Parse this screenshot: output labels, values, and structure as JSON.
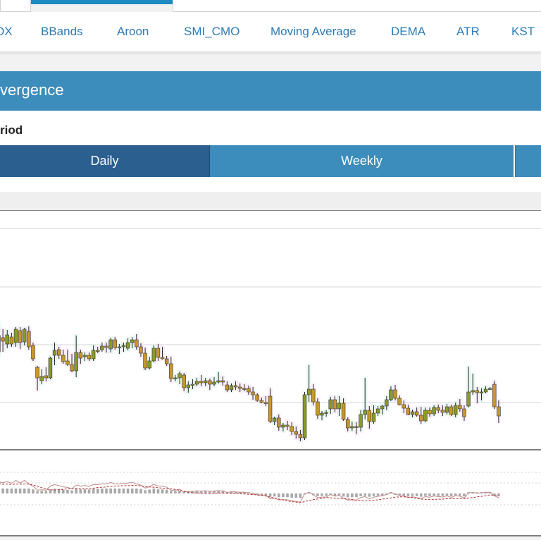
{
  "nav_tabs": [
    "DX",
    "BBands",
    "Aroon",
    "SMI_CMO",
    "Moving Average",
    "DEMA",
    "ATR",
    "KST"
  ],
  "panel": {
    "title": "vergence",
    "period_label": "riod",
    "segments": [
      "Daily",
      "Weekly"
    ]
  },
  "colors": {
    "accent": "#1e8bc3",
    "panel_header": "#3c8dbc",
    "segment_active": "#2a5f8f",
    "candle_up": "#8a9a28",
    "candle_down": "#c9962a",
    "volume_bar": "#a8a8a8",
    "macd_line": "#c08a8a",
    "signal_line": "#b03030"
  },
  "chart_data": {
    "type": "candlestick",
    "series": [
      {
        "type": "candlestick",
        "points": [
          {
            "o": 499,
            "h": 458,
            "l": 505,
            "c": 476
          },
          {
            "o": 479,
            "h": 467,
            "l": 499,
            "c": 484
          },
          {
            "o": 488,
            "h": 468,
            "l": 494,
            "c": 475
          },
          {
            "o": 478,
            "h": 472,
            "l": 492,
            "c": 488
          },
          {
            "o": 486,
            "h": 464,
            "l": 492,
            "c": 467
          },
          {
            "o": 469,
            "h": 464,
            "l": 495,
            "c": 486
          },
          {
            "o": 485,
            "h": 465,
            "l": 490,
            "c": 467
          },
          {
            "o": 470,
            "h": 463,
            "l": 496,
            "c": 492
          },
          {
            "o": 490,
            "h": 486,
            "l": 512,
            "c": 509
          },
          {
            "o": 521,
            "h": 519,
            "l": 554,
            "c": 536
          },
          {
            "o": 540,
            "h": 524,
            "l": 545,
            "c": 534
          },
          {
            "o": 533,
            "h": 521,
            "l": 541,
            "c": 536
          },
          {
            "o": 536,
            "h": 506,
            "l": 538,
            "c": 508
          },
          {
            "o": 504,
            "h": 486,
            "l": 518,
            "c": 497
          },
          {
            "o": 496,
            "h": 492,
            "l": 509,
            "c": 504
          },
          {
            "o": 504,
            "h": 496,
            "l": 516,
            "c": 513
          },
          {
            "o": 512,
            "h": 496,
            "l": 519,
            "c": 517
          },
          {
            "o": 517,
            "h": 502,
            "l": 528,
            "c": 526
          },
          {
            "o": 526,
            "h": 476,
            "l": 535,
            "c": 500
          },
          {
            "o": 500,
            "h": 496,
            "l": 516,
            "c": 508
          },
          {
            "o": 506,
            "h": 500,
            "l": 512,
            "c": 504
          },
          {
            "o": 504,
            "h": 500,
            "l": 512,
            "c": 509
          },
          {
            "o": 509,
            "h": 490,
            "l": 512,
            "c": 497
          },
          {
            "o": 497,
            "h": 492,
            "l": 501,
            "c": 498
          },
          {
            "o": 496,
            "h": 486,
            "l": 499,
            "c": 491
          },
          {
            "o": 491,
            "h": 486,
            "l": 500,
            "c": 493
          },
          {
            "o": 495,
            "h": 479,
            "l": 500,
            "c": 482
          },
          {
            "o": 482,
            "h": 478,
            "l": 496,
            "c": 493
          },
          {
            "o": 493,
            "h": 488,
            "l": 502,
            "c": 492
          },
          {
            "o": 492,
            "h": 486,
            "l": 499,
            "c": 490
          },
          {
            "o": 494,
            "h": 480,
            "l": 497,
            "c": 486
          },
          {
            "o": 486,
            "h": 478,
            "l": 494,
            "c": 482
          },
          {
            "o": 482,
            "h": 474,
            "l": 496,
            "c": 492
          },
          {
            "o": 492,
            "h": 487,
            "l": 506,
            "c": 501
          },
          {
            "o": 501,
            "h": 493,
            "l": 525,
            "c": 522
          },
          {
            "o": 522,
            "h": 506,
            "l": 524,
            "c": 512
          },
          {
            "o": 512,
            "h": 490,
            "l": 514,
            "c": 494
          },
          {
            "o": 494,
            "h": 488,
            "l": 512,
            "c": 507
          },
          {
            "o": 507,
            "h": 492,
            "l": 510,
            "c": 509
          },
          {
            "o": 509,
            "h": 505,
            "l": 519,
            "c": 516
          },
          {
            "o": 516,
            "h": 506,
            "l": 542,
            "c": 537
          },
          {
            "o": 537,
            "h": 532,
            "l": 541,
            "c": 536
          },
          {
            "o": 536,
            "h": 527,
            "l": 545,
            "c": 530
          },
          {
            "o": 532,
            "h": 529,
            "l": 555,
            "c": 550
          },
          {
            "o": 550,
            "h": 541,
            "l": 557,
            "c": 546
          },
          {
            "o": 546,
            "h": 538,
            "l": 552,
            "c": 545
          },
          {
            "o": 545,
            "h": 536,
            "l": 548,
            "c": 541
          },
          {
            "o": 541,
            "h": 532,
            "l": 548,
            "c": 543
          },
          {
            "o": 543,
            "h": 536,
            "l": 548,
            "c": 540
          },
          {
            "o": 540,
            "h": 537,
            "l": 553,
            "c": 545
          },
          {
            "o": 545,
            "h": 535,
            "l": 548,
            "c": 542
          },
          {
            "o": 542,
            "h": 528,
            "l": 544,
            "c": 540
          },
          {
            "o": 540,
            "h": 534,
            "l": 547,
            "c": 542
          },
          {
            "o": 546,
            "h": 541,
            "l": 556,
            "c": 553
          },
          {
            "o": 553,
            "h": 544,
            "l": 556,
            "c": 547
          },
          {
            "o": 547,
            "h": 541,
            "l": 553,
            "c": 549
          },
          {
            "o": 549,
            "h": 544,
            "l": 556,
            "c": 551
          },
          {
            "o": 551,
            "h": 545,
            "l": 555,
            "c": 551
          },
          {
            "o": 551,
            "h": 547,
            "l": 560,
            "c": 556
          },
          {
            "o": 556,
            "h": 549,
            "l": 567,
            "c": 560
          },
          {
            "o": 560,
            "h": 558,
            "l": 570,
            "c": 568
          },
          {
            "o": 568,
            "h": 564,
            "l": 572,
            "c": 571
          },
          {
            "o": 571,
            "h": 562,
            "l": 576,
            "c": 572
          },
          {
            "o": 562,
            "h": 551,
            "l": 600,
            "c": 598
          },
          {
            "o": 598,
            "h": 591,
            "l": 603,
            "c": 593
          },
          {
            "o": 593,
            "h": 588,
            "l": 611,
            "c": 606
          },
          {
            "o": 606,
            "h": 600,
            "l": 612,
            "c": 603
          },
          {
            "o": 603,
            "h": 597,
            "l": 610,
            "c": 605
          },
          {
            "o": 605,
            "h": 599,
            "l": 617,
            "c": 612
          },
          {
            "o": 612,
            "h": 605,
            "l": 622,
            "c": 616
          },
          {
            "o": 616,
            "h": 610,
            "l": 626,
            "c": 621
          },
          {
            "o": 621,
            "h": 556,
            "l": 624,
            "c": 560
          },
          {
            "o": 560,
            "h": 518,
            "l": 570,
            "c": 552
          },
          {
            "o": 552,
            "h": 545,
            "l": 575,
            "c": 570
          },
          {
            "o": 570,
            "h": 565,
            "l": 594,
            "c": 589
          },
          {
            "o": 589,
            "h": 583,
            "l": 596,
            "c": 586
          },
          {
            "o": 586,
            "h": 582,
            "l": 591,
            "c": 585
          },
          {
            "o": 580,
            "h": 563,
            "l": 587,
            "c": 567
          },
          {
            "o": 567,
            "h": 562,
            "l": 585,
            "c": 580
          },
          {
            "o": 580,
            "h": 562,
            "l": 590,
            "c": 572
          },
          {
            "o": 572,
            "h": 565,
            "l": 597,
            "c": 595
          },
          {
            "o": 595,
            "h": 592,
            "l": 612,
            "c": 607
          },
          {
            "o": 607,
            "h": 598,
            "l": 611,
            "c": 605
          },
          {
            "o": 605,
            "h": 599,
            "l": 616,
            "c": 606
          },
          {
            "o": 606,
            "h": 582,
            "l": 612,
            "c": 588
          },
          {
            "o": 588,
            "h": 536,
            "l": 595,
            "c": 582
          },
          {
            "o": 582,
            "h": 576,
            "l": 608,
            "c": 598
          },
          {
            "o": 598,
            "h": 575,
            "l": 601,
            "c": 586
          },
          {
            "o": 586,
            "h": 576,
            "l": 590,
            "c": 580
          },
          {
            "o": 580,
            "h": 574,
            "l": 588,
            "c": 576
          },
          {
            "o": 576,
            "h": 562,
            "l": 582,
            "c": 567
          },
          {
            "o": 567,
            "h": 548,
            "l": 569,
            "c": 553
          },
          {
            "o": 553,
            "h": 546,
            "l": 568,
            "c": 565
          },
          {
            "o": 565,
            "h": 561,
            "l": 575,
            "c": 574
          },
          {
            "o": 574,
            "h": 568,
            "l": 586,
            "c": 579
          },
          {
            "o": 579,
            "h": 574,
            "l": 589,
            "c": 588
          },
          {
            "o": 588,
            "h": 581,
            "l": 592,
            "c": 584
          },
          {
            "o": 584,
            "h": 578,
            "l": 591,
            "c": 589
          },
          {
            "o": 589,
            "h": 577,
            "l": 601,
            "c": 597
          },
          {
            "o": 597,
            "h": 578,
            "l": 599,
            "c": 582
          },
          {
            "o": 582,
            "h": 578,
            "l": 591,
            "c": 587
          },
          {
            "o": 587,
            "h": 575,
            "l": 590,
            "c": 578
          },
          {
            "o": 578,
            "h": 574,
            "l": 586,
            "c": 582
          },
          {
            "o": 582,
            "h": 575,
            "l": 590,
            "c": 585
          },
          {
            "o": 585,
            "h": 573,
            "l": 588,
            "c": 577
          },
          {
            "o": 577,
            "h": 574,
            "l": 590,
            "c": 588
          },
          {
            "o": 588,
            "h": 571,
            "l": 592,
            "c": 575
          },
          {
            "o": 575,
            "h": 566,
            "l": 584,
            "c": 580
          },
          {
            "o": 580,
            "h": 575,
            "l": 597,
            "c": 591
          },
          {
            "o": 576,
            "h": 520,
            "l": 578,
            "c": 556
          },
          {
            "o": 556,
            "h": 530,
            "l": 560,
            "c": 554
          },
          {
            "o": 554,
            "h": 549,
            "l": 572,
            "c": 557
          },
          {
            "o": 557,
            "h": 551,
            "l": 568,
            "c": 556
          },
          {
            "o": 556,
            "h": 548,
            "l": 558,
            "c": 552
          },
          {
            "o": 552,
            "h": 549,
            "l": 553,
            "c": 551
          },
          {
            "o": 545,
            "h": 540,
            "l": 580,
            "c": 577
          },
          {
            "o": 577,
            "h": 568,
            "l": 600,
            "c": 590
          }
        ]
      },
      {
        "type": "bar",
        "name": "volume"
      },
      {
        "type": "line",
        "name": "macd"
      },
      {
        "type": "line",
        "name": "signal",
        "style": "dashed"
      }
    ],
    "grid": true
  }
}
